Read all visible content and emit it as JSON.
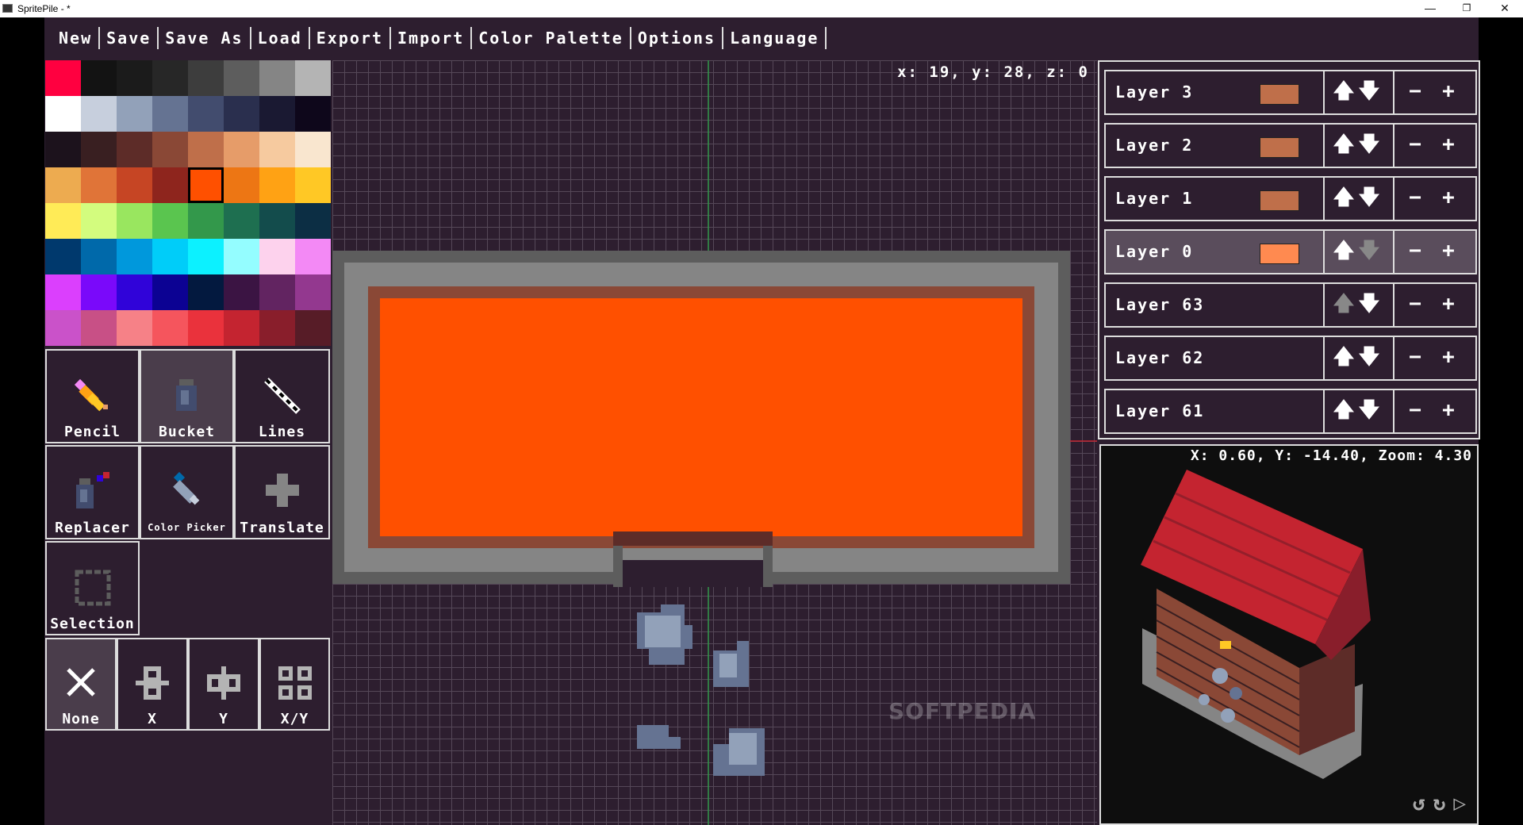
{
  "window": {
    "title": "SpritePile - *",
    "minimize_icon": "—",
    "restore_icon": "❐",
    "close_icon": "✕"
  },
  "menu": [
    "New",
    "Save",
    "Save As",
    "Load",
    "Export",
    "Import",
    "Color Palette",
    "Options",
    "Language"
  ],
  "palette": {
    "colors": [
      "#ff0040",
      "#131313",
      "#1b1b1b",
      "#272727",
      "#3d3d3d",
      "#5d5d5d",
      "#858585",
      "#b4b4b4",
      "#ffffff",
      "#c7cfdd",
      "#92a1b9",
      "#657392",
      "#424c6e",
      "#2a2f4e",
      "#1a1932",
      "#0e071b",
      "#1c121c",
      "#391f21",
      "#5d2c28",
      "#8a4836",
      "#bf6f4a",
      "#e69c69",
      "#f6ca9f",
      "#f9e6cf",
      "#edab50",
      "#e07438",
      "#c64524",
      "#8e251d",
      "#ff5000",
      "#ed7614",
      "#ffa214",
      "#ffc825",
      "#ffeb57",
      "#d3fc7e",
      "#99e65f",
      "#5ac54f",
      "#33984b",
      "#1e6f50",
      "#134c4c",
      "#0c2e44",
      "#00396d",
      "#0069aa",
      "#0098dc",
      "#00cdf9",
      "#0cf1ff",
      "#94fdff",
      "#fdd2ed",
      "#f389f5",
      "#db3ffd",
      "#7a09fa",
      "#3003d9",
      "#0c0293",
      "#03193f",
      "#3b1443",
      "#622461",
      "#93388f",
      "#ca52c9",
      "#c85086",
      "#f68187",
      "#f5555d",
      "#ea323c",
      "#c42430",
      "#891e2b",
      "#571c27"
    ],
    "selected_index": 28
  },
  "tools": {
    "pencil": "Pencil",
    "bucket": "Bucket",
    "lines": "Lines",
    "replacer": "Replacer",
    "color_picker": "Color Picker",
    "translate": "Translate",
    "selection": "Selection",
    "mirror_none": "None",
    "mirror_x": "X",
    "mirror_y": "Y",
    "mirror_xy": "X/Y"
  },
  "canvas": {
    "coords": "x: 19, y: 28, z: 0"
  },
  "layers": [
    {
      "name": "Layer  3",
      "thumb": "#bf6f4a"
    },
    {
      "name": "Layer  2",
      "thumb": "#bf6f4a"
    },
    {
      "name": "Layer  1",
      "thumb": "#bf6f4a"
    },
    {
      "name": "Layer  0",
      "thumb": "#ff8a50"
    },
    {
      "name": "Layer  63",
      "thumb": ""
    },
    {
      "name": "Layer  62",
      "thumb": ""
    },
    {
      "name": "Layer  61",
      "thumb": ""
    }
  ],
  "active_layer_index": 3,
  "layer_icons": {
    "up": "🡅",
    "down": "🡇",
    "minus": "−",
    "plus": "+"
  },
  "preview": {
    "coords": "X: 0.60, Y: -14.40, Zoom: 4.30"
  },
  "watermark": "SOFTPEDIA"
}
